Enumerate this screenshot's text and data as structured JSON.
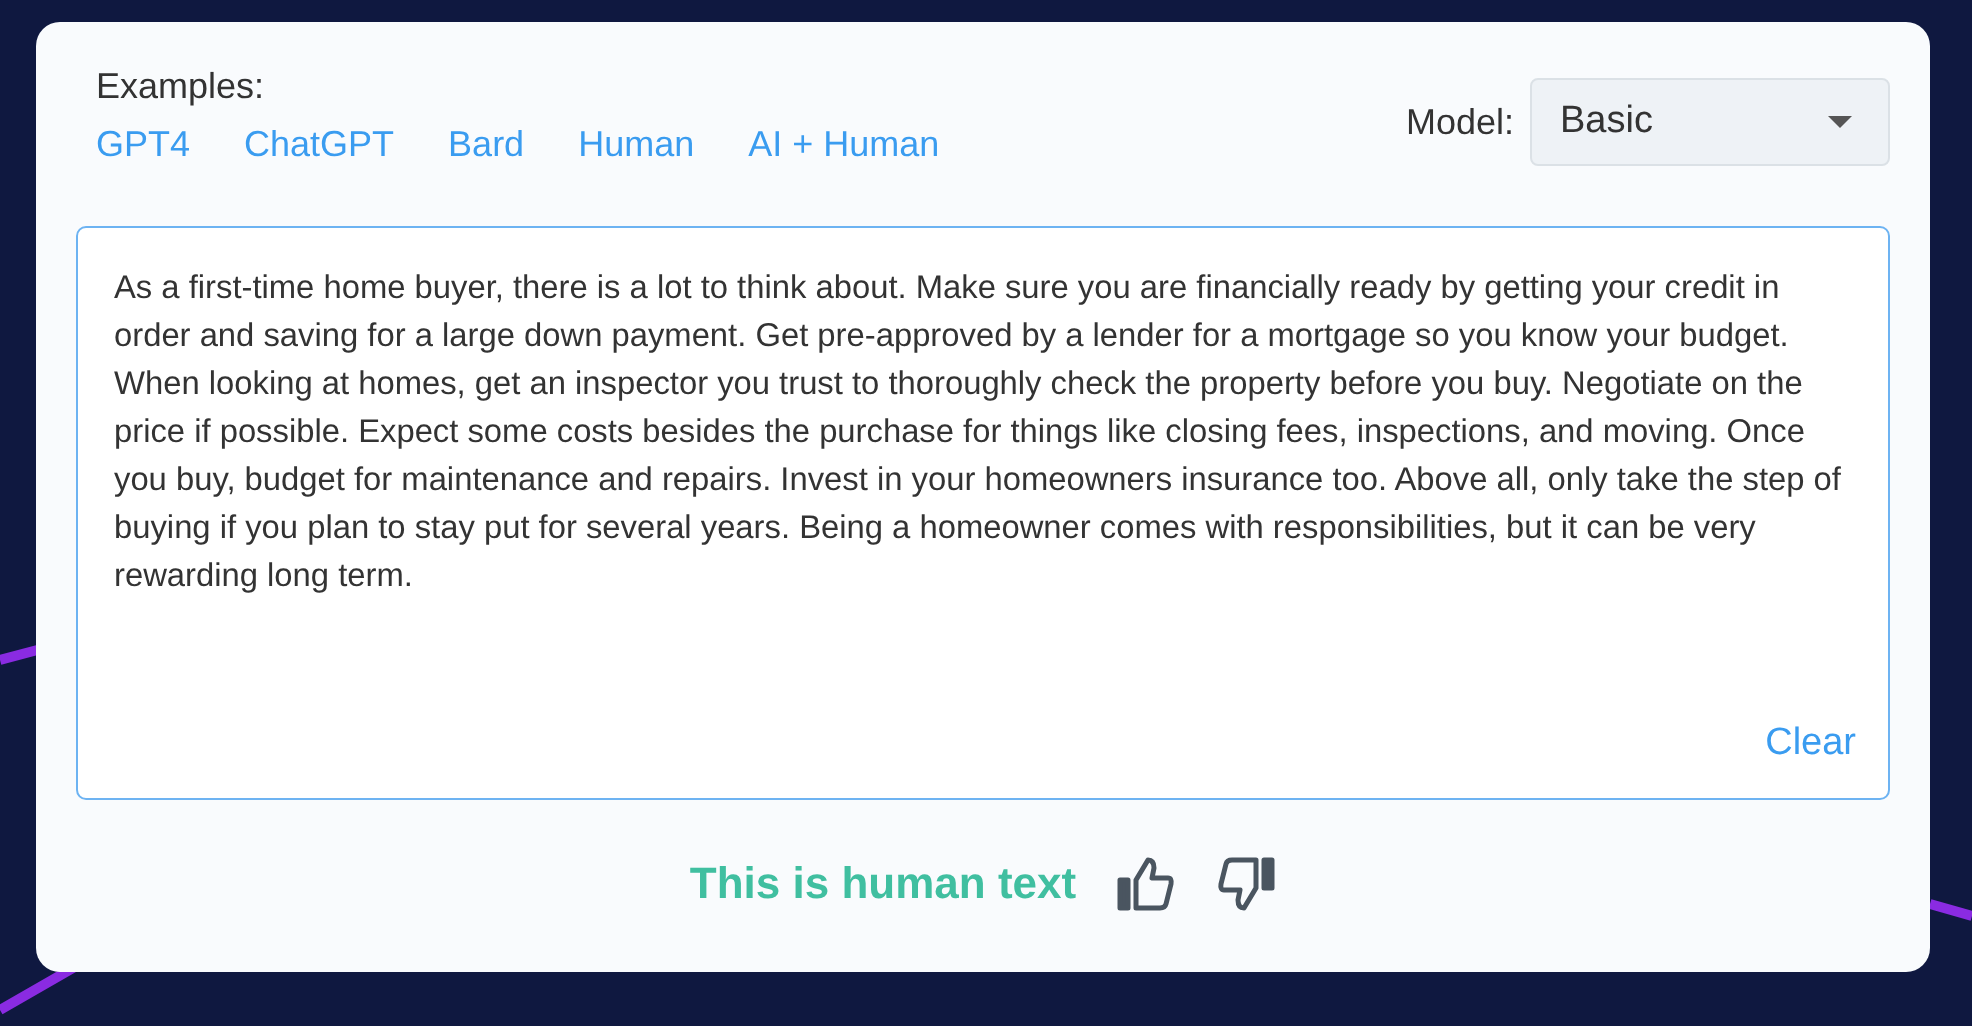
{
  "examples": {
    "label": "Examples:",
    "links": [
      "GPT4",
      "ChatGPT",
      "Bard",
      "Human",
      "AI + Human"
    ]
  },
  "model": {
    "label": "Model:",
    "value": "Basic"
  },
  "editor": {
    "text": "As a first-time home buyer, there is a lot to think about. Make sure you are financially ready by getting your credit in order and saving for a large down payment. Get pre-approved by a lender for a mortgage so you know your budget. When looking at homes, get an inspector you trust to thoroughly check the property before you buy. Negotiate on the price if possible. Expect some costs besides the purchase for things like closing fees, inspections, and moving. Once you buy, budget for maintenance and repairs. Invest in your homeowners insurance too. Above all, only take the step of buying if you plan to stay put for several years. Being a homeowner comes with responsibilities, but it can be very rewarding long term.",
    "clear": "Clear"
  },
  "result": {
    "text": "This is human text"
  }
}
